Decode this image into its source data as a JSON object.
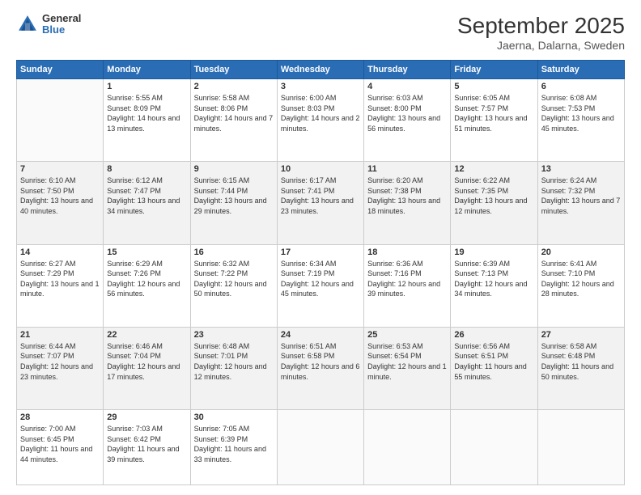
{
  "header": {
    "logo_general": "General",
    "logo_blue": "Blue",
    "title": "September 2025",
    "subtitle": "Jaerna, Dalarna, Sweden"
  },
  "weekdays": [
    "Sunday",
    "Monday",
    "Tuesday",
    "Wednesday",
    "Thursday",
    "Friday",
    "Saturday"
  ],
  "weeks": [
    [
      {
        "day": "",
        "sunrise": "",
        "sunset": "",
        "daylight": ""
      },
      {
        "day": "1",
        "sunrise": "Sunrise: 5:55 AM",
        "sunset": "Sunset: 8:09 PM",
        "daylight": "Daylight: 14 hours and 13 minutes."
      },
      {
        "day": "2",
        "sunrise": "Sunrise: 5:58 AM",
        "sunset": "Sunset: 8:06 PM",
        "daylight": "Daylight: 14 hours and 7 minutes."
      },
      {
        "day": "3",
        "sunrise": "Sunrise: 6:00 AM",
        "sunset": "Sunset: 8:03 PM",
        "daylight": "Daylight: 14 hours and 2 minutes."
      },
      {
        "day": "4",
        "sunrise": "Sunrise: 6:03 AM",
        "sunset": "Sunset: 8:00 PM",
        "daylight": "Daylight: 13 hours and 56 minutes."
      },
      {
        "day": "5",
        "sunrise": "Sunrise: 6:05 AM",
        "sunset": "Sunset: 7:57 PM",
        "daylight": "Daylight: 13 hours and 51 minutes."
      },
      {
        "day": "6",
        "sunrise": "Sunrise: 6:08 AM",
        "sunset": "Sunset: 7:53 PM",
        "daylight": "Daylight: 13 hours and 45 minutes."
      }
    ],
    [
      {
        "day": "7",
        "sunrise": "Sunrise: 6:10 AM",
        "sunset": "Sunset: 7:50 PM",
        "daylight": "Daylight: 13 hours and 40 minutes."
      },
      {
        "day": "8",
        "sunrise": "Sunrise: 6:12 AM",
        "sunset": "Sunset: 7:47 PM",
        "daylight": "Daylight: 13 hours and 34 minutes."
      },
      {
        "day": "9",
        "sunrise": "Sunrise: 6:15 AM",
        "sunset": "Sunset: 7:44 PM",
        "daylight": "Daylight: 13 hours and 29 minutes."
      },
      {
        "day": "10",
        "sunrise": "Sunrise: 6:17 AM",
        "sunset": "Sunset: 7:41 PM",
        "daylight": "Daylight: 13 hours and 23 minutes."
      },
      {
        "day": "11",
        "sunrise": "Sunrise: 6:20 AM",
        "sunset": "Sunset: 7:38 PM",
        "daylight": "Daylight: 13 hours and 18 minutes."
      },
      {
        "day": "12",
        "sunrise": "Sunrise: 6:22 AM",
        "sunset": "Sunset: 7:35 PM",
        "daylight": "Daylight: 13 hours and 12 minutes."
      },
      {
        "day": "13",
        "sunrise": "Sunrise: 6:24 AM",
        "sunset": "Sunset: 7:32 PM",
        "daylight": "Daylight: 13 hours and 7 minutes."
      }
    ],
    [
      {
        "day": "14",
        "sunrise": "Sunrise: 6:27 AM",
        "sunset": "Sunset: 7:29 PM",
        "daylight": "Daylight: 13 hours and 1 minute."
      },
      {
        "day": "15",
        "sunrise": "Sunrise: 6:29 AM",
        "sunset": "Sunset: 7:26 PM",
        "daylight": "Daylight: 12 hours and 56 minutes."
      },
      {
        "day": "16",
        "sunrise": "Sunrise: 6:32 AM",
        "sunset": "Sunset: 7:22 PM",
        "daylight": "Daylight: 12 hours and 50 minutes."
      },
      {
        "day": "17",
        "sunrise": "Sunrise: 6:34 AM",
        "sunset": "Sunset: 7:19 PM",
        "daylight": "Daylight: 12 hours and 45 minutes."
      },
      {
        "day": "18",
        "sunrise": "Sunrise: 6:36 AM",
        "sunset": "Sunset: 7:16 PM",
        "daylight": "Daylight: 12 hours and 39 minutes."
      },
      {
        "day": "19",
        "sunrise": "Sunrise: 6:39 AM",
        "sunset": "Sunset: 7:13 PM",
        "daylight": "Daylight: 12 hours and 34 minutes."
      },
      {
        "day": "20",
        "sunrise": "Sunrise: 6:41 AM",
        "sunset": "Sunset: 7:10 PM",
        "daylight": "Daylight: 12 hours and 28 minutes."
      }
    ],
    [
      {
        "day": "21",
        "sunrise": "Sunrise: 6:44 AM",
        "sunset": "Sunset: 7:07 PM",
        "daylight": "Daylight: 12 hours and 23 minutes."
      },
      {
        "day": "22",
        "sunrise": "Sunrise: 6:46 AM",
        "sunset": "Sunset: 7:04 PM",
        "daylight": "Daylight: 12 hours and 17 minutes."
      },
      {
        "day": "23",
        "sunrise": "Sunrise: 6:48 AM",
        "sunset": "Sunset: 7:01 PM",
        "daylight": "Daylight: 12 hours and 12 minutes."
      },
      {
        "day": "24",
        "sunrise": "Sunrise: 6:51 AM",
        "sunset": "Sunset: 6:58 PM",
        "daylight": "Daylight: 12 hours and 6 minutes."
      },
      {
        "day": "25",
        "sunrise": "Sunrise: 6:53 AM",
        "sunset": "Sunset: 6:54 PM",
        "daylight": "Daylight: 12 hours and 1 minute."
      },
      {
        "day": "26",
        "sunrise": "Sunrise: 6:56 AM",
        "sunset": "Sunset: 6:51 PM",
        "daylight": "Daylight: 11 hours and 55 minutes."
      },
      {
        "day": "27",
        "sunrise": "Sunrise: 6:58 AM",
        "sunset": "Sunset: 6:48 PM",
        "daylight": "Daylight: 11 hours and 50 minutes."
      }
    ],
    [
      {
        "day": "28",
        "sunrise": "Sunrise: 7:00 AM",
        "sunset": "Sunset: 6:45 PM",
        "daylight": "Daylight: 11 hours and 44 minutes."
      },
      {
        "day": "29",
        "sunrise": "Sunrise: 7:03 AM",
        "sunset": "Sunset: 6:42 PM",
        "daylight": "Daylight: 11 hours and 39 minutes."
      },
      {
        "day": "30",
        "sunrise": "Sunrise: 7:05 AM",
        "sunset": "Sunset: 6:39 PM",
        "daylight": "Daylight: 11 hours and 33 minutes."
      },
      {
        "day": "",
        "sunrise": "",
        "sunset": "",
        "daylight": ""
      },
      {
        "day": "",
        "sunrise": "",
        "sunset": "",
        "daylight": ""
      },
      {
        "day": "",
        "sunrise": "",
        "sunset": "",
        "daylight": ""
      },
      {
        "day": "",
        "sunrise": "",
        "sunset": "",
        "daylight": ""
      }
    ]
  ]
}
